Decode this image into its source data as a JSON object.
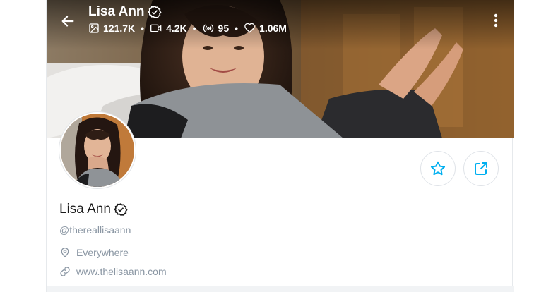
{
  "header": {
    "name": "Lisa Ann",
    "stats": {
      "photos": "121.7K",
      "videos": "4.2K",
      "streams": "95",
      "likes": "1.06M"
    },
    "icons": {
      "back": "arrow-left-icon",
      "verified": "verified-badge-icon",
      "photos": "image-icon",
      "videos": "video-camera-icon",
      "streams": "broadcast-icon",
      "likes": "heart-icon",
      "more": "more-vertical-icon"
    }
  },
  "profile": {
    "display_name": "Lisa Ann",
    "username": "@thereallisaann",
    "location": "Everywhere",
    "website": "www.thelisaann.com",
    "icons": {
      "location": "map-pin-icon",
      "website": "link-icon",
      "favorite": "star-icon",
      "share": "share-icon"
    }
  },
  "colors": {
    "accent": "#00aff0",
    "muted_text": "#8a96a3",
    "name_text": "#1b1b1b"
  }
}
